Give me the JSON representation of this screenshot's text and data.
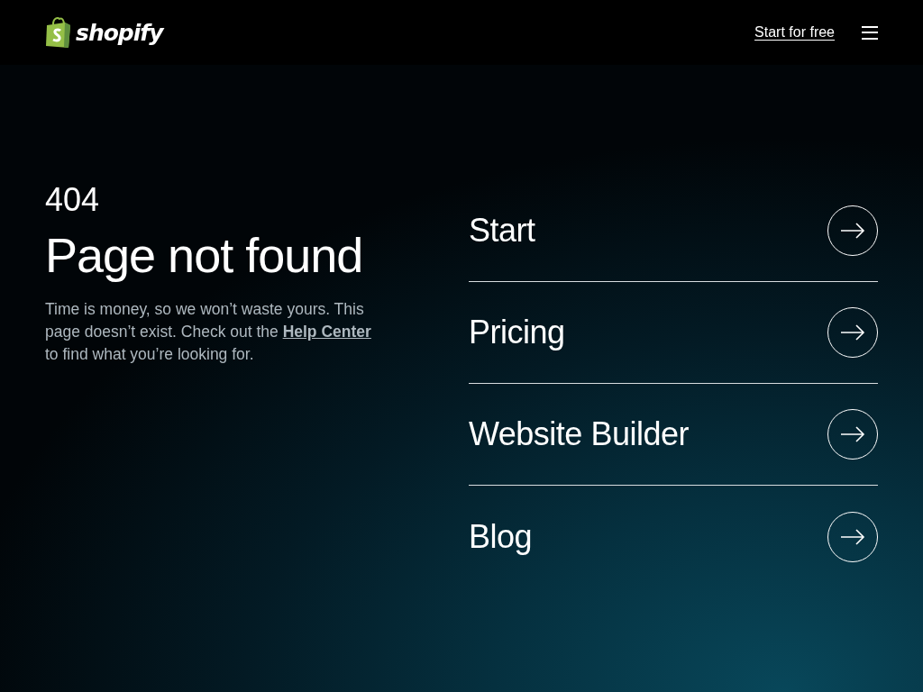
{
  "header": {
    "logo": "shopify",
    "cta": "Start for free"
  },
  "error": {
    "code": "404",
    "title": "Page not found",
    "message_before": "Time is money, so we won’t waste yours. This page doesn’t exist. Check out the ",
    "link": "Help Center",
    "message_after": " to find what you’re looking for."
  },
  "links": [
    {
      "label": "Start"
    },
    {
      "label": "Pricing"
    },
    {
      "label": "Website Builder"
    },
    {
      "label": "Blog"
    }
  ]
}
